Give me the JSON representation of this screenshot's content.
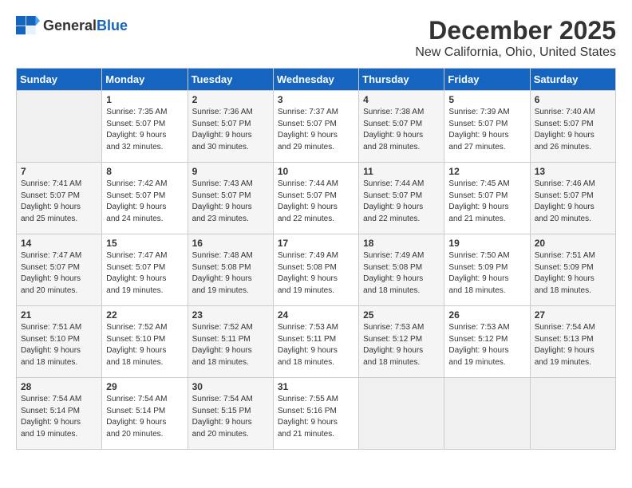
{
  "header": {
    "logo_general": "General",
    "logo_blue": "Blue",
    "month": "December 2025",
    "location": "New California, Ohio, United States"
  },
  "days_of_week": [
    "Sunday",
    "Monday",
    "Tuesday",
    "Wednesday",
    "Thursday",
    "Friday",
    "Saturday"
  ],
  "weeks": [
    [
      {
        "day": "",
        "info": ""
      },
      {
        "day": "1",
        "info": "Sunrise: 7:35 AM\nSunset: 5:07 PM\nDaylight: 9 hours\nand 32 minutes."
      },
      {
        "day": "2",
        "info": "Sunrise: 7:36 AM\nSunset: 5:07 PM\nDaylight: 9 hours\nand 30 minutes."
      },
      {
        "day": "3",
        "info": "Sunrise: 7:37 AM\nSunset: 5:07 PM\nDaylight: 9 hours\nand 29 minutes."
      },
      {
        "day": "4",
        "info": "Sunrise: 7:38 AM\nSunset: 5:07 PM\nDaylight: 9 hours\nand 28 minutes."
      },
      {
        "day": "5",
        "info": "Sunrise: 7:39 AM\nSunset: 5:07 PM\nDaylight: 9 hours\nand 27 minutes."
      },
      {
        "day": "6",
        "info": "Sunrise: 7:40 AM\nSunset: 5:07 PM\nDaylight: 9 hours\nand 26 minutes."
      }
    ],
    [
      {
        "day": "7",
        "info": "Sunrise: 7:41 AM\nSunset: 5:07 PM\nDaylight: 9 hours\nand 25 minutes."
      },
      {
        "day": "8",
        "info": "Sunrise: 7:42 AM\nSunset: 5:07 PM\nDaylight: 9 hours\nand 24 minutes."
      },
      {
        "day": "9",
        "info": "Sunrise: 7:43 AM\nSunset: 5:07 PM\nDaylight: 9 hours\nand 23 minutes."
      },
      {
        "day": "10",
        "info": "Sunrise: 7:44 AM\nSunset: 5:07 PM\nDaylight: 9 hours\nand 22 minutes."
      },
      {
        "day": "11",
        "info": "Sunrise: 7:44 AM\nSunset: 5:07 PM\nDaylight: 9 hours\nand 22 minutes."
      },
      {
        "day": "12",
        "info": "Sunrise: 7:45 AM\nSunset: 5:07 PM\nDaylight: 9 hours\nand 21 minutes."
      },
      {
        "day": "13",
        "info": "Sunrise: 7:46 AM\nSunset: 5:07 PM\nDaylight: 9 hours\nand 20 minutes."
      }
    ],
    [
      {
        "day": "14",
        "info": "Sunrise: 7:47 AM\nSunset: 5:07 PM\nDaylight: 9 hours\nand 20 minutes."
      },
      {
        "day": "15",
        "info": "Sunrise: 7:47 AM\nSunset: 5:07 PM\nDaylight: 9 hours\nand 19 minutes."
      },
      {
        "day": "16",
        "info": "Sunrise: 7:48 AM\nSunset: 5:08 PM\nDaylight: 9 hours\nand 19 minutes."
      },
      {
        "day": "17",
        "info": "Sunrise: 7:49 AM\nSunset: 5:08 PM\nDaylight: 9 hours\nand 19 minutes."
      },
      {
        "day": "18",
        "info": "Sunrise: 7:49 AM\nSunset: 5:08 PM\nDaylight: 9 hours\nand 18 minutes."
      },
      {
        "day": "19",
        "info": "Sunrise: 7:50 AM\nSunset: 5:09 PM\nDaylight: 9 hours\nand 18 minutes."
      },
      {
        "day": "20",
        "info": "Sunrise: 7:51 AM\nSunset: 5:09 PM\nDaylight: 9 hours\nand 18 minutes."
      }
    ],
    [
      {
        "day": "21",
        "info": "Sunrise: 7:51 AM\nSunset: 5:10 PM\nDaylight: 9 hours\nand 18 minutes."
      },
      {
        "day": "22",
        "info": "Sunrise: 7:52 AM\nSunset: 5:10 PM\nDaylight: 9 hours\nand 18 minutes."
      },
      {
        "day": "23",
        "info": "Sunrise: 7:52 AM\nSunset: 5:11 PM\nDaylight: 9 hours\nand 18 minutes."
      },
      {
        "day": "24",
        "info": "Sunrise: 7:53 AM\nSunset: 5:11 PM\nDaylight: 9 hours\nand 18 minutes."
      },
      {
        "day": "25",
        "info": "Sunrise: 7:53 AM\nSunset: 5:12 PM\nDaylight: 9 hours\nand 18 minutes."
      },
      {
        "day": "26",
        "info": "Sunrise: 7:53 AM\nSunset: 5:12 PM\nDaylight: 9 hours\nand 19 minutes."
      },
      {
        "day": "27",
        "info": "Sunrise: 7:54 AM\nSunset: 5:13 PM\nDaylight: 9 hours\nand 19 minutes."
      }
    ],
    [
      {
        "day": "28",
        "info": "Sunrise: 7:54 AM\nSunset: 5:14 PM\nDaylight: 9 hours\nand 19 minutes."
      },
      {
        "day": "29",
        "info": "Sunrise: 7:54 AM\nSunset: 5:14 PM\nDaylight: 9 hours\nand 20 minutes."
      },
      {
        "day": "30",
        "info": "Sunrise: 7:54 AM\nSunset: 5:15 PM\nDaylight: 9 hours\nand 20 minutes."
      },
      {
        "day": "31",
        "info": "Sunrise: 7:55 AM\nSunset: 5:16 PM\nDaylight: 9 hours\nand 21 minutes."
      },
      {
        "day": "",
        "info": ""
      },
      {
        "day": "",
        "info": ""
      },
      {
        "day": "",
        "info": ""
      }
    ]
  ]
}
